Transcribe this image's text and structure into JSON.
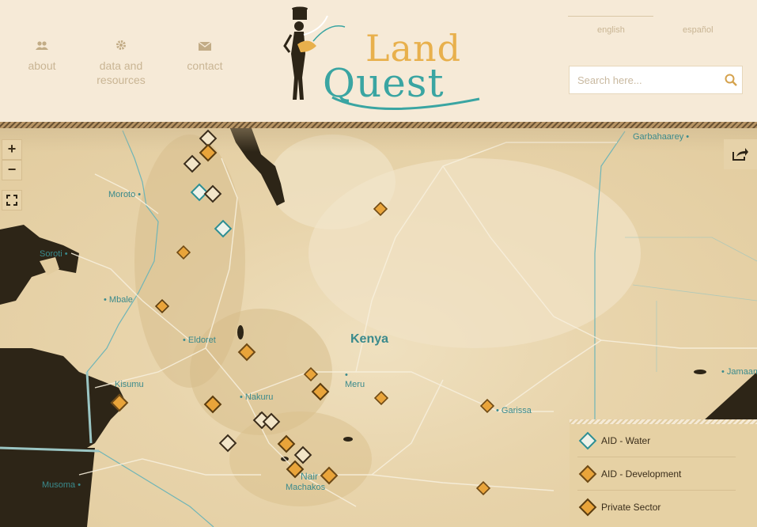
{
  "nav": {
    "about": "about",
    "data_resources": "data and resources",
    "contact": "contact"
  },
  "logo": {
    "line1": "Land",
    "line2": "Quest"
  },
  "languages": {
    "english": "english",
    "spanish": "español"
  },
  "search": {
    "placeholder": "Search here..."
  },
  "map": {
    "country_label": "Kenya",
    "cities": {
      "garbahaarey": "Garbahaarey",
      "moroto": "Moroto",
      "soroti": "Soroti",
      "mbale": "Mbale",
      "eldoret": "Eldoret",
      "kisumu": "Kisumu",
      "meru": "Meru",
      "nakuru": "Nakuru",
      "garissa": "Garissa",
      "jamaam": "Jamaam",
      "musoma": "Musoma",
      "nairobi": "Nair",
      "machakos": "Machakos"
    },
    "controls": {
      "zoom_in": "+",
      "zoom_out": "−"
    }
  },
  "legend": {
    "items": [
      {
        "label": "AID - Water",
        "icon": "water-marker-icon"
      },
      {
        "label": "AID - Development",
        "icon": "development-marker-icon"
      },
      {
        "label": "Private Sector",
        "icon": "private-sector-marker-icon"
      }
    ]
  },
  "colors": {
    "header_bg": "#f6ead7",
    "map_land": "#e8d4ab",
    "water_dark": "#2d2517",
    "teal": "#3aa5a2",
    "orange": "#e9a43a",
    "legend_bg": "#e6d1a4"
  }
}
